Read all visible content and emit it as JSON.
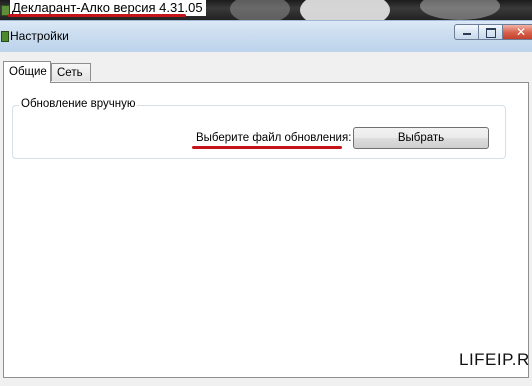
{
  "background_app": {
    "title": "Декларант-Алко версия 4.31.05",
    "highlight_color": "#c4141a"
  },
  "window": {
    "title": "Настройки",
    "caption_buttons": {
      "minimize_icon": "minimize-icon",
      "maximize_icon": "maximize-icon",
      "close_icon": "close-icon"
    }
  },
  "tabs": [
    {
      "label": "Общие",
      "active": true
    },
    {
      "label": "Сеть",
      "active": false
    }
  ],
  "general_tab": {
    "group_caption": "Обновление вручную",
    "choose_file_label": "Выберите файл обновления:",
    "choose_button_label": "Выбрать"
  },
  "watermark": "LIFEIP.R"
}
